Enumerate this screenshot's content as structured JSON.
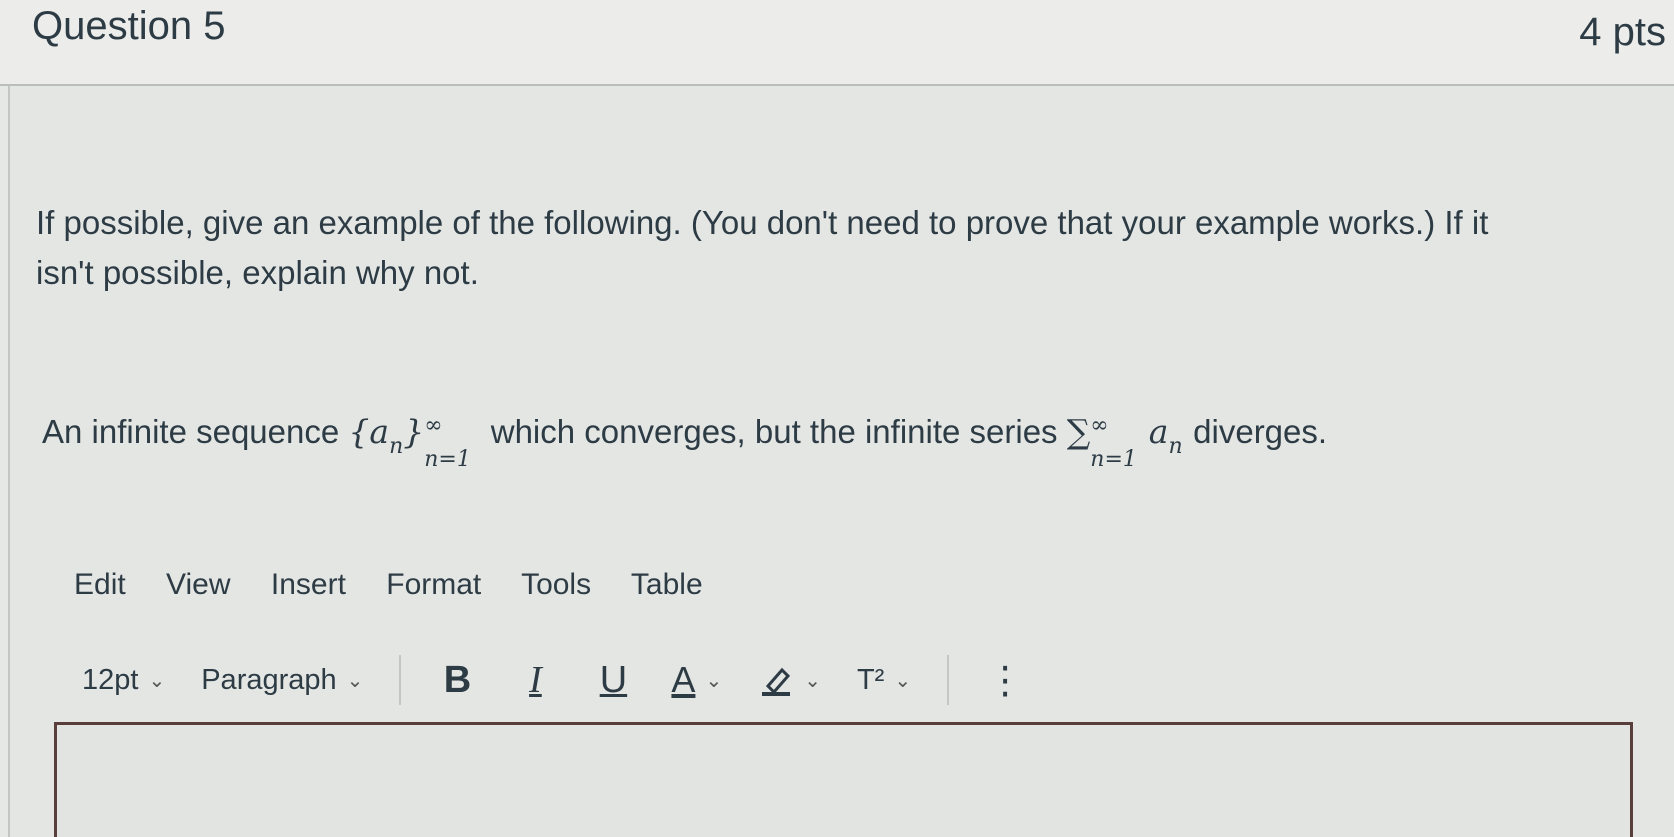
{
  "header": {
    "title": "Question 5",
    "points": "4 pts"
  },
  "prompt": {
    "line1": "If possible, give an example of the following. (You don't need to prove that your example works.) If it",
    "line2": "isn't possible, explain why not."
  },
  "problem": {
    "text_before": "An infinite sequence",
    "seq_open": "{",
    "seq_var": "a",
    "seq_var_sub": "n",
    "seq_close": "}",
    "seq_sup": "∞",
    "seq_sub": "n=1",
    "text_middle": "which converges, but the infinite series",
    "sum_symbol": "∑",
    "sum_sup": "∞",
    "sum_sub": "n=1",
    "sum_var": "a",
    "sum_var_sub": "n",
    "text_after": "diverges."
  },
  "menubar": {
    "items": [
      "Edit",
      "View",
      "Insert",
      "Format",
      "Tools",
      "Table"
    ]
  },
  "toolbar": {
    "font_size": "12pt",
    "block_format": "Paragraph",
    "bold_label": "B",
    "italic_label": "I",
    "underline_label": "U",
    "text_color_label": "A",
    "superscript_label": "T²",
    "more_label": "⋮"
  },
  "editor": {
    "value": ""
  }
}
